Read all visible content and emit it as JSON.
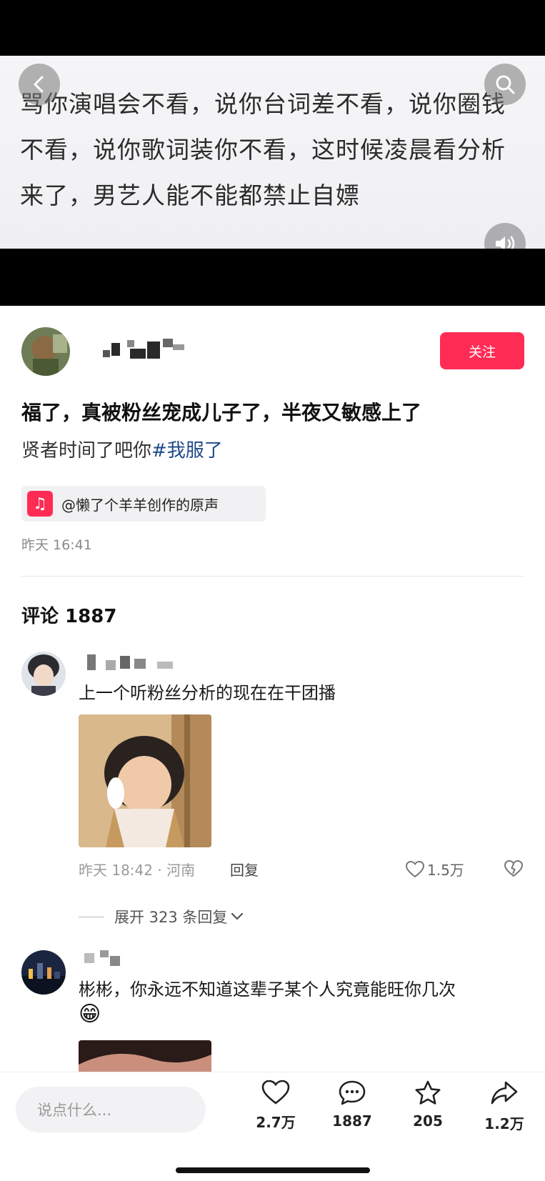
{
  "video": {
    "caption": "骂你演唱会不看，说你台词差不看，说你圈钱不看，说你歌词装你不看，这时候凌晨看分析来了，男艺人能不能都禁止自嫖",
    "back_icon": "chevron-left-icon",
    "search_icon": "search-icon",
    "volume_icon": "volume-icon"
  },
  "author": {
    "follow_label": "关注"
  },
  "post": {
    "title": "福了，真被粉丝宠成儿子了，半夜又敏感上了",
    "subtitle": "贤者时间了吧你",
    "hashtag": "#我服了",
    "music_label": "@懒了个羊羊创作的原声",
    "time": "昨天 16:41"
  },
  "comments": {
    "header": "评论 1887",
    "items": [
      {
        "text": "上一个听粉丝分析的现在在干团播",
        "meta": "昨天 18:42 · 河南",
        "reply_label": "回复",
        "likes": "1.5万",
        "expand_label": "展开 323 条回复"
      },
      {
        "text": "彬彬，你永远不知道这辈子某个人究竟能旺你几次",
        "emoji": "😁"
      }
    ]
  },
  "bottom_bar": {
    "input_placeholder": "说点什么...",
    "likes": "2.7万",
    "comments": "1887",
    "favorites": "205",
    "shares": "1.2万"
  },
  "colors": {
    "accent": "#fe2c55",
    "hashtag": "#1f4a8a"
  }
}
